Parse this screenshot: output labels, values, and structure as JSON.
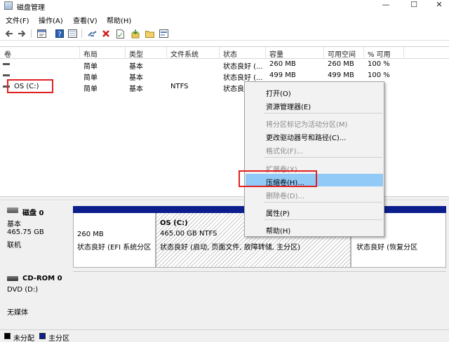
{
  "window": {
    "title": "磁盘管理",
    "controls": {
      "minimize": "—",
      "maximize": "☐",
      "close": "✕"
    }
  },
  "menu": [
    "文件(F)",
    "操作(A)",
    "查看(V)",
    "帮助(H)"
  ],
  "toolbar": {
    "icons": [
      "back-arrow-icon",
      "forward-arrow-icon",
      "properties-icon",
      "help-icon",
      "list-view-icon",
      "connect-icon",
      "delete-icon",
      "document-icon",
      "import-icon",
      "folder-icon",
      "panel-icon"
    ]
  },
  "volume_table": {
    "headers": [
      "卷",
      "布局",
      "类型",
      "文件系统",
      "状态",
      "容量",
      "可用空间",
      "% 可用"
    ],
    "rows": [
      {
        "name": "",
        "layout": "简单",
        "type": "基本",
        "fs": "",
        "status": "状态良好 (...",
        "capacity": "260 MB",
        "free": "260 MB",
        "pct": "100 %"
      },
      {
        "name": "",
        "layout": "简单",
        "type": "基本",
        "fs": "",
        "status": "状态良好 (...",
        "capacity": "499 MB",
        "free": "499 MB",
        "pct": "100 %"
      },
      {
        "name": "OS (C:)",
        "layout": "简单",
        "type": "基本",
        "fs": "NTFS",
        "status": "状态良好 (...",
        "capacity": "",
        "free": "",
        "pct": ""
      }
    ]
  },
  "context_menu": {
    "items": [
      {
        "label": "打开(O)",
        "enabled": true
      },
      {
        "label": "资源管理器(E)",
        "enabled": true
      },
      {
        "label": "将分区标记为活动分区(M)",
        "enabled": false
      },
      {
        "label": "更改驱动器号和路径(C)...",
        "enabled": true
      },
      {
        "label": "格式化(F)...",
        "enabled": false
      },
      {
        "label": "扩展卷(X)...",
        "enabled": false
      },
      {
        "label": "压缩卷(H)...",
        "enabled": true,
        "highlighted": true
      },
      {
        "label": "删除卷(D)...",
        "enabled": false
      },
      {
        "label": "属性(P)",
        "enabled": true
      },
      {
        "label": "帮助(H)",
        "enabled": true
      }
    ]
  },
  "disks": {
    "disk0": {
      "name": "磁盘 0",
      "type": "基本",
      "size": "465.75 GB",
      "status": "联机",
      "partitions": [
        {
          "size": "260 MB",
          "status": "状态良好 (EFI 系统分区"
        },
        {
          "name": "OS  (C:)",
          "size": "465.00 GB NTFS",
          "status": "状态良好 (启动, 页面文件, 故障转储, 主分区)"
        },
        {
          "status": "状态良好 (恢复分区"
        }
      ]
    },
    "cdrom0": {
      "name": "CD-ROM 0",
      "type": "DVD (D:)",
      "media": "无媒体"
    }
  },
  "legend": [
    {
      "label": "未分配",
      "color": "#000000"
    },
    {
      "label": "主分区",
      "color": "#0c1e8c"
    }
  ],
  "colors": {
    "primary_partition": "#0c1e8c",
    "highlight": "#91c9f7",
    "annotation_red": "#e02020"
  }
}
